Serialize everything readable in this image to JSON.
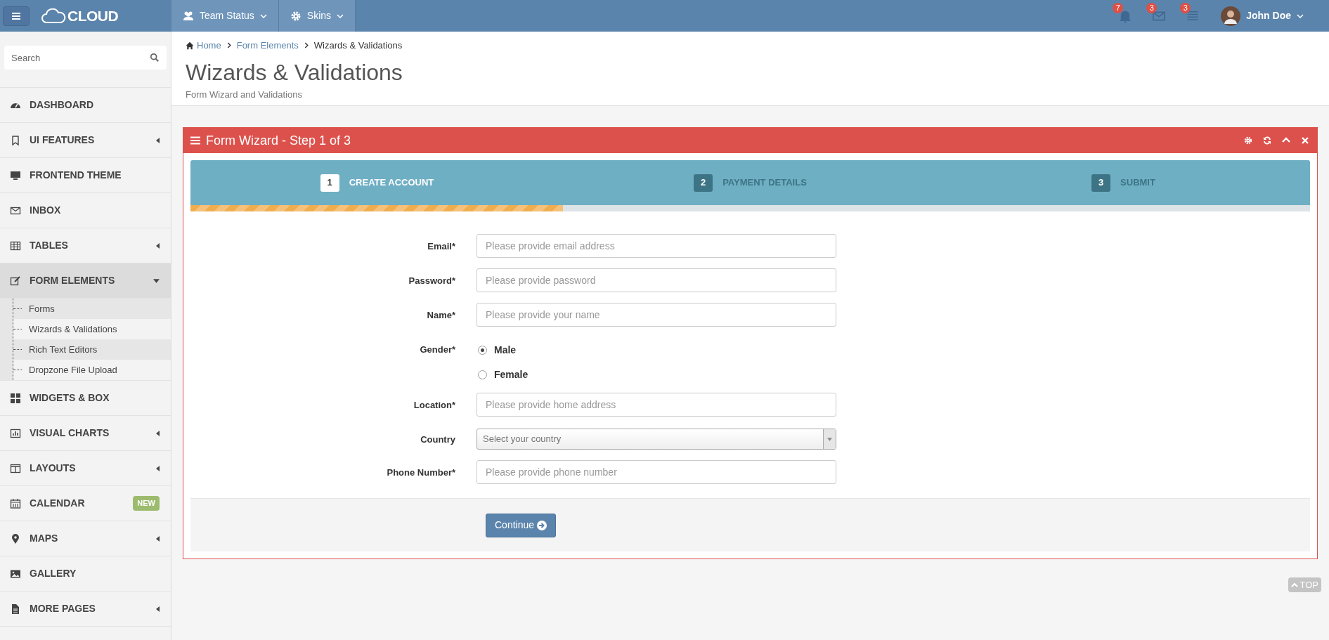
{
  "topbar": {
    "logo": "CLOUD",
    "menus": [
      {
        "label": "Team Status"
      },
      {
        "label": "Skins"
      }
    ],
    "notifications": [
      {
        "count": "7"
      },
      {
        "count": "3"
      },
      {
        "count": "3"
      }
    ],
    "user": {
      "name": "John Doe"
    }
  },
  "sidebar": {
    "search": {
      "placeholder": "Search"
    },
    "items": [
      {
        "label": "DASHBOARD",
        "has_arrow": false,
        "expanded": false
      },
      {
        "label": "UI FEATURES",
        "has_arrow": true,
        "expanded": false
      },
      {
        "label": "FRONTEND THEME",
        "has_arrow": false,
        "expanded": false
      },
      {
        "label": "INBOX",
        "has_arrow": false,
        "expanded": false
      },
      {
        "label": "TABLES",
        "has_arrow": true,
        "expanded": false
      },
      {
        "label": "FORM ELEMENTS",
        "has_arrow": true,
        "expanded": true,
        "children": [
          {
            "label": "Forms",
            "shaded": true
          },
          {
            "label": "Wizards & Validations",
            "shaded": false
          },
          {
            "label": "Rich Text Editors",
            "shaded": true
          },
          {
            "label": "Dropzone File Upload",
            "shaded": false
          }
        ]
      },
      {
        "label": "WIDGETS & BOX",
        "has_arrow": false,
        "expanded": false
      },
      {
        "label": "VISUAL CHARTS",
        "has_arrow": true,
        "expanded": false
      },
      {
        "label": "LAYOUTS",
        "has_arrow": true,
        "expanded": false
      },
      {
        "label": "CALENDAR",
        "has_arrow": false,
        "expanded": false,
        "badge": "NEW"
      },
      {
        "label": "MAPS",
        "has_arrow": true,
        "expanded": false
      },
      {
        "label": "GALLERY",
        "has_arrow": false,
        "expanded": false
      },
      {
        "label": "MORE PAGES",
        "has_arrow": true,
        "expanded": false
      }
    ]
  },
  "breadcrumb": [
    {
      "label": "Home",
      "link": true
    },
    {
      "label": "Form Elements",
      "link": true
    },
    {
      "label": "Wizards & Validations",
      "link": false
    }
  ],
  "page": {
    "title": "Wizards & Validations",
    "subtitle": "Form Wizard and Validations"
  },
  "panel": {
    "title": "Form Wizard - Step 1 of 3",
    "steps": [
      {
        "number": "1",
        "label": "CREATE ACCOUNT",
        "selected": true
      },
      {
        "number": "2",
        "label": "PAYMENT DETAILS",
        "selected": false
      },
      {
        "number": "3",
        "label": "SUBMIT",
        "selected": false
      }
    ],
    "progress": {
      "level": 0.333
    },
    "fields": [
      {
        "kind": "input",
        "label": "Email*",
        "placeholder": "Please provide email address"
      },
      {
        "kind": "input",
        "label": "Password*",
        "placeholder": "Please provide password"
      },
      {
        "kind": "input",
        "label": "Name*",
        "placeholder": "Please provide your name"
      },
      {
        "kind": "radio",
        "label": "Gender*",
        "options": [
          {
            "label": "Male",
            "selected": true
          },
          {
            "label": "Female",
            "selected": false
          }
        ]
      },
      {
        "kind": "input",
        "label": "Location*",
        "placeholder": "Please provide home address"
      },
      {
        "kind": "select",
        "label": "Country",
        "placeholder": "Select your country"
      },
      {
        "kind": "input",
        "label": "Phone Number*",
        "placeholder": "Please provide phone number"
      }
    ],
    "button": "Continue"
  },
  "back_to_top": "TOP"
}
